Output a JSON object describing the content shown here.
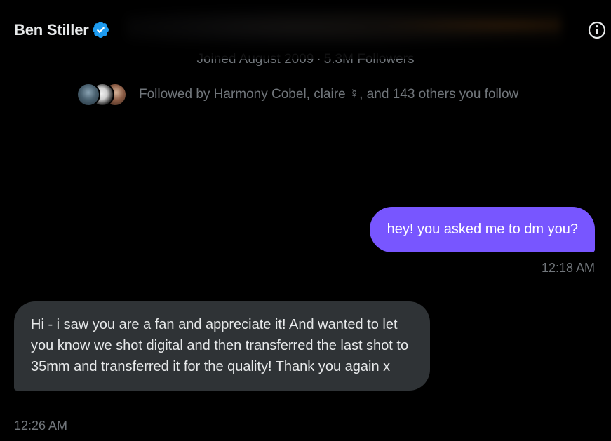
{
  "header": {
    "title": "Ben Stiller",
    "verified_icon": "verified-badge-icon",
    "info_icon": "info-icon"
  },
  "profile": {
    "joined": "Joined August 2009",
    "separator": "·",
    "followers": "5.3M Followers",
    "followed_by": "Followed by Harmony Cobel, claire ☿, and 143 others you follow"
  },
  "messages": [
    {
      "direction": "outgoing",
      "text": "hey! you asked me to dm you?",
      "time": "12:18 AM"
    },
    {
      "direction": "incoming",
      "text": "Hi - i saw you are a fan and appreciate it! And wanted to let you know we shot digital and then transferred the last shot to 35mm and transferred it for the quality! Thank you again x",
      "time": "12:26 AM"
    }
  ],
  "colors": {
    "background": "#000000",
    "outgoing_bubble": "#7856ff",
    "incoming_bubble": "#2f3336",
    "verified_blue": "#1d9bf0",
    "secondary_text": "#71767b"
  }
}
